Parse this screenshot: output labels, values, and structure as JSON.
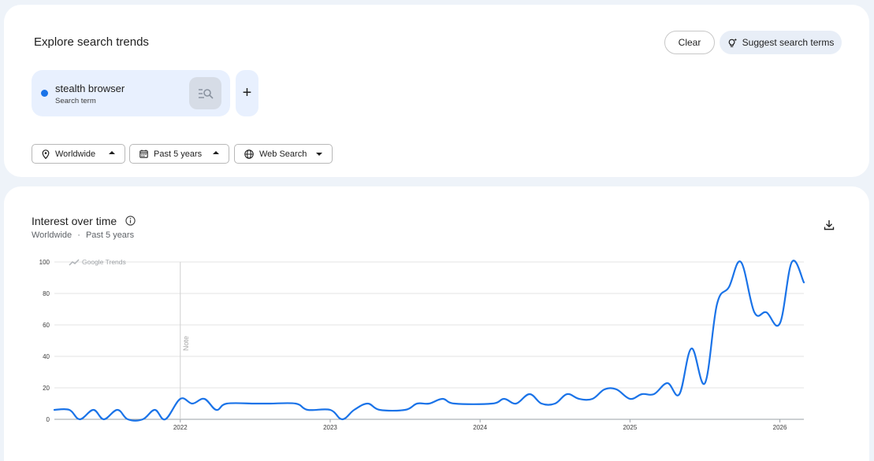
{
  "header": {
    "title": "Explore search trends",
    "clear_label": "Clear",
    "suggest_label": "Suggest search terms"
  },
  "term": {
    "name": "stealth browser",
    "type": "Search term",
    "color": "#1a73e8",
    "add_symbol": "+"
  },
  "filters": {
    "location": "Worldwide",
    "time": "Past 5 years",
    "property": "Web Search"
  },
  "section": {
    "title": "Interest over time",
    "subtitle_location": "Worldwide",
    "subtitle_separator": "·",
    "subtitle_time": "Past 5 years",
    "watermark": "Google Trends",
    "note_label": "Note"
  },
  "chart_data": {
    "type": "line",
    "y_ticks": [
      "0",
      "20",
      "40",
      "60",
      "80",
      "100"
    ],
    "x_ticks": [
      "2022",
      "2023",
      "2024",
      "2025",
      "2026"
    ],
    "ylim": [
      0,
      100
    ],
    "grid": true,
    "series": [
      {
        "color": "#1a73e8",
        "points": [
          [
            2021.16,
            6
          ],
          [
            2021.26,
            6
          ],
          [
            2021.33,
            0
          ],
          [
            2021.42,
            6
          ],
          [
            2021.49,
            0
          ],
          [
            2021.58,
            6
          ],
          [
            2021.65,
            0
          ],
          [
            2021.75,
            0
          ],
          [
            2021.83,
            6
          ],
          [
            2021.9,
            0
          ],
          [
            2022.0,
            13
          ],
          [
            2022.08,
            10
          ],
          [
            2022.16,
            13
          ],
          [
            2022.24,
            6
          ],
          [
            2022.31,
            10
          ],
          [
            2022.5,
            10
          ],
          [
            2022.6,
            10
          ],
          [
            2022.77,
            10
          ],
          [
            2022.85,
            6
          ],
          [
            2023.0,
            6
          ],
          [
            2023.08,
            0
          ],
          [
            2023.16,
            6
          ],
          [
            2023.25,
            10
          ],
          [
            2023.33,
            6
          ],
          [
            2023.5,
            6
          ],
          [
            2023.58,
            10
          ],
          [
            2023.66,
            10
          ],
          [
            2023.75,
            13
          ],
          [
            2023.83,
            10
          ],
          [
            2024.08,
            10
          ],
          [
            2024.16,
            13
          ],
          [
            2024.24,
            10
          ],
          [
            2024.33,
            16
          ],
          [
            2024.41,
            10
          ],
          [
            2024.5,
            10
          ],
          [
            2024.58,
            16
          ],
          [
            2024.66,
            13
          ],
          [
            2024.75,
            13
          ],
          [
            2024.83,
            19
          ],
          [
            2024.91,
            19
          ],
          [
            2025.0,
            13
          ],
          [
            2025.08,
            16
          ],
          [
            2025.16,
            16
          ],
          [
            2025.25,
            23
          ],
          [
            2025.33,
            16
          ],
          [
            2025.41,
            45
          ],
          [
            2025.5,
            23
          ],
          [
            2025.58,
            73
          ],
          [
            2025.66,
            84
          ],
          [
            2025.74,
            100
          ],
          [
            2025.83,
            68
          ],
          [
            2025.91,
            68
          ],
          [
            2026.0,
            61
          ],
          [
            2026.08,
            100
          ],
          [
            2026.16,
            87
          ]
        ]
      }
    ]
  }
}
